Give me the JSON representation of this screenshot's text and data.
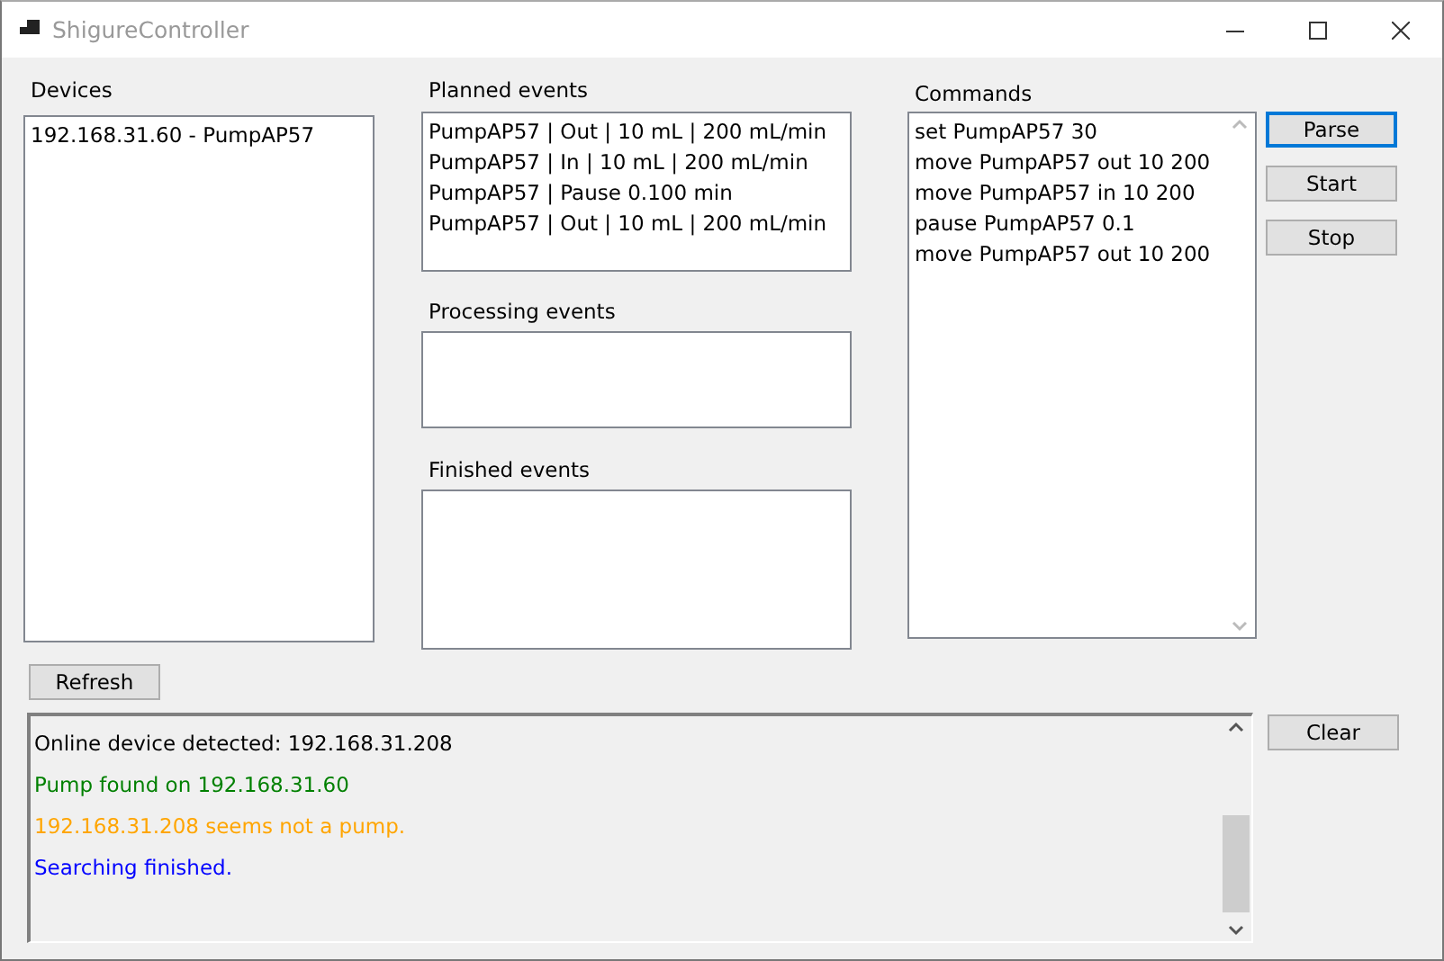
{
  "window": {
    "title": "ShigureController"
  },
  "devices": {
    "label": "Devices",
    "items": [
      "192.168.31.60 - PumpAP57"
    ]
  },
  "planned_events": {
    "label": "Planned events",
    "items": [
      "PumpAP57 | Out | 10 mL | 200 mL/min",
      "PumpAP57 | In | 10 mL | 200 mL/min",
      "PumpAP57 | Pause 0.100 min",
      "PumpAP57 | Out | 10 mL | 200 mL/min"
    ]
  },
  "processing_events": {
    "label": "Processing events"
  },
  "finished_events": {
    "label": "Finished events"
  },
  "commands": {
    "label": "Commands",
    "lines": [
      "set PumpAP57 30",
      "move PumpAP57 out 10 200",
      "move PumpAP57 in 10 200",
      "pause PumpAP57 0.1",
      "move PumpAP57 out 10 200"
    ]
  },
  "command_buttons": [
    {
      "label": "Parse",
      "focused": true
    },
    {
      "label": "Start",
      "focused": false
    },
    {
      "label": "Stop",
      "focused": false
    }
  ],
  "refresh_button": {
    "label": "Refresh"
  },
  "log": [
    {
      "text": "Online device detected: 192.168.31.208",
      "color": "#000000"
    },
    {
      "text": "Pump found on 192.168.31.60",
      "color": "#008000"
    },
    {
      "text": "192.168.31.208 seems not a pump.",
      "color": "#ffa500"
    },
    {
      "text": "Searching finished.",
      "color": "#0000ff"
    }
  ],
  "clear_button": {
    "label": "Clear"
  }
}
